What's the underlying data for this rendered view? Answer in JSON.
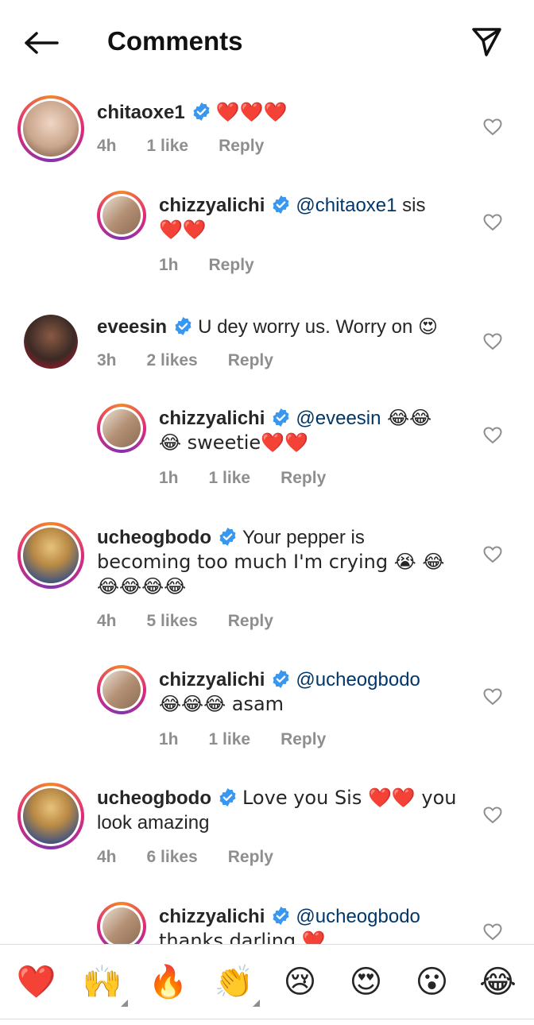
{
  "header": {
    "title": "Comments"
  },
  "comments": [
    {
      "username": "chitaoxe1",
      "text": "",
      "emojis": "❤️❤️❤️",
      "time": "4h",
      "likes": "1 like",
      "reply": "Reply",
      "avatar_color": "#c9a58c"
    },
    {
      "username": "chizzyalichi",
      "mention": "@chitaoxe1",
      "text": " sis",
      "line2": "❤️❤️",
      "time": "1h",
      "likes": "",
      "reply": "Reply",
      "avatar_color": "#8a6d55"
    },
    {
      "username": "eveesin",
      "text": "U dey worry us. Worry on ",
      "emojis": "😍",
      "time": "3h",
      "likes": "2 likes",
      "reply": "Reply",
      "avatar_color": "#3b2a24"
    },
    {
      "username": "chizzyalichi",
      "mention": "@eveesin",
      "text": " 😂😂",
      "line2": "😂 sweetie❤️❤️",
      "time": "1h",
      "likes": "1 like",
      "reply": "Reply",
      "avatar_color": "#8a6d55"
    },
    {
      "username": "ucheogbodo",
      "text": "Your pepper is",
      "line2": "becoming too much I'm crying 😭 😂",
      "line3": "😂😂😂😂",
      "time": "4h",
      "likes": "5 likes",
      "reply": "Reply",
      "avatar_color": "#2d4a8a"
    },
    {
      "username": "chizzyalichi",
      "mention": "@ucheogbodo",
      "text": "",
      "line2": "😂😂😂 asam",
      "time": "1h",
      "likes": "1 like",
      "reply": "Reply",
      "avatar_color": "#8a6d55"
    },
    {
      "username": "ucheogbodo",
      "text": "Love you Sis ❤️❤️ you",
      "line2": "look amazing",
      "time": "4h",
      "likes": "6 likes",
      "reply": "Reply",
      "avatar_color": "#2d4a8a"
    },
    {
      "username": "chizzyalichi",
      "mention": "@ucheogbodo",
      "text": "",
      "line2": "thanks darling ❤️",
      "avatar_color": "#8a6d55"
    }
  ],
  "reactions": [
    "❤️",
    "🙌",
    "🔥",
    "👏",
    "😢",
    "😍",
    "😮",
    "😂"
  ],
  "colors": {
    "mention": "#00376b",
    "verified": "#3897f0",
    "meta": "#8e8e8e"
  }
}
